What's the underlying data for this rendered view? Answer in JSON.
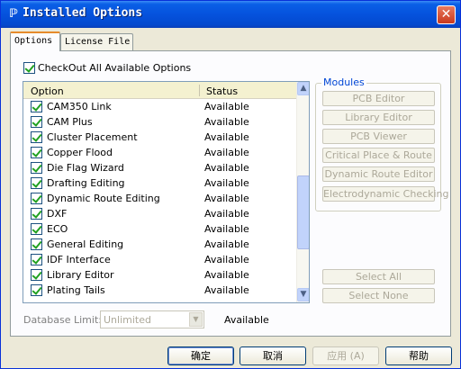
{
  "window": {
    "title": "Installed Options",
    "icon_glyph": "ℙ",
    "close_glyph": "✕"
  },
  "tabs": [
    {
      "label": "Options",
      "active": true
    },
    {
      "label": "License File",
      "active": false
    }
  ],
  "checkout_all": {
    "label": "CheckOut All Available Options",
    "checked": true
  },
  "list": {
    "headers": {
      "option": "Option",
      "status": "Status"
    },
    "rows": [
      {
        "option": "CAM350 Link",
        "status": "Available",
        "checked": true
      },
      {
        "option": "CAM Plus",
        "status": "Available",
        "checked": true
      },
      {
        "option": "Cluster Placement",
        "status": "Available",
        "checked": true
      },
      {
        "option": "Copper Flood",
        "status": "Available",
        "checked": true
      },
      {
        "option": "Die Flag Wizard",
        "status": "Available",
        "checked": true
      },
      {
        "option": "Drafting Editing",
        "status": "Available",
        "checked": true
      },
      {
        "option": "Dynamic Route Editing",
        "status": "Available",
        "checked": true
      },
      {
        "option": "DXF",
        "status": "Available",
        "checked": true
      },
      {
        "option": "ECO",
        "status": "Available",
        "checked": true
      },
      {
        "option": "General Editing",
        "status": "Available",
        "checked": true
      },
      {
        "option": "IDF Interface",
        "status": "Available",
        "checked": true
      },
      {
        "option": "Library Editor",
        "status": "Available",
        "checked": true
      },
      {
        "option": "Plating Tails",
        "status": "Available",
        "checked": true
      }
    ],
    "scroll": {
      "up_glyph": "▲",
      "down_glyph": "▼"
    }
  },
  "modules": {
    "title": "Modules",
    "buttons": [
      "PCB Editor",
      "Library Editor",
      "PCB Viewer",
      "Critical Place & Route",
      "Dynamic Route Editor",
      "Electrodynamic Checking"
    ]
  },
  "selection": {
    "select_all": "Select All",
    "select_none": "Select None"
  },
  "database_limit": {
    "label": "Database Limit:",
    "value": "Unlimited",
    "status": "Available",
    "arrow_glyph": "▼"
  },
  "dialog_buttons": {
    "ok": "确定",
    "cancel": "取消",
    "apply": "应用 (A)",
    "help": "帮助"
  },
  "colors": {
    "title_bar": "#0552dd",
    "check_mark": "#21a121",
    "modules_title": "#0046d5",
    "disabled_text": "#aca899"
  }
}
